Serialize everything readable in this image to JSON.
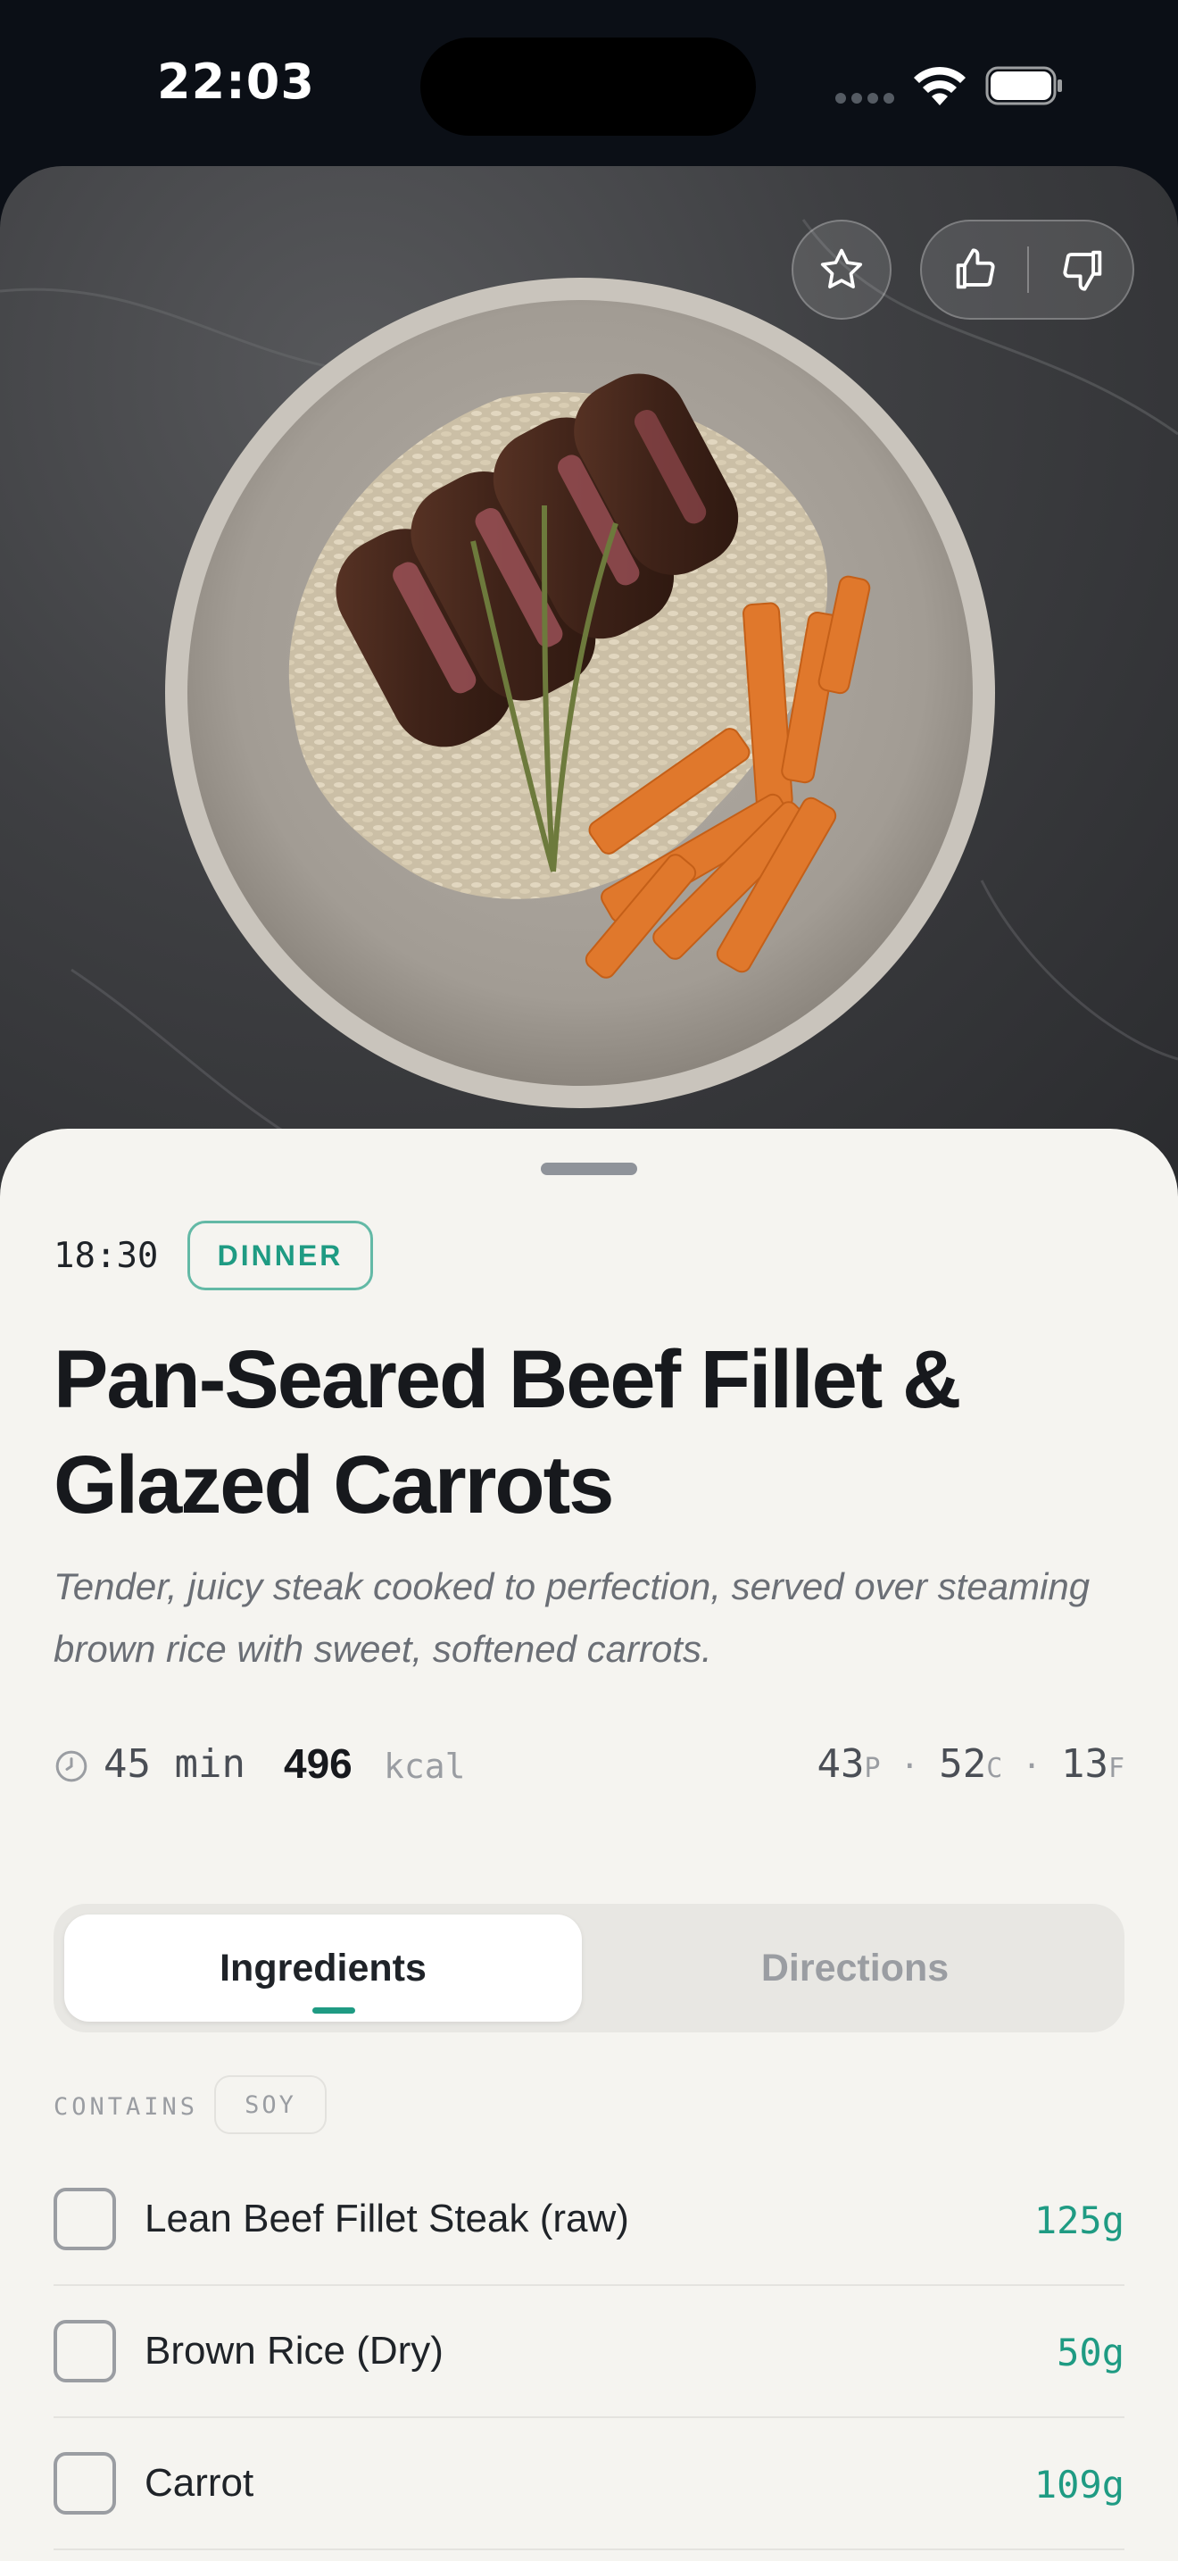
{
  "status_bar": {
    "time": "22:03"
  },
  "hero": {
    "image_alt": "Pan-seared beef fillet with thyme over brown rice and glazed carrots in a grey bowl",
    "favorite_icon": "star-icon",
    "like_icon": "thumbs-up-icon",
    "dislike_icon": "thumbs-down-icon"
  },
  "meal": {
    "time": "18:30",
    "type": "DINNER",
    "title": "Pan-Seared Beef Fillet & Glazed Carrots",
    "description": "Tender, juicy steak cooked to perfection, served over steaming brown rice with sweet, softened carrots.",
    "duration": "45 min",
    "kcal": "496",
    "kcal_unit": "kcal",
    "macros": {
      "protein": "43",
      "protein_unit": "P",
      "carbs": "52",
      "carbs_unit": "C",
      "fat": "13",
      "fat_unit": "F",
      "separator": "·"
    }
  },
  "tabs": [
    {
      "label": "Ingredients",
      "active": true
    },
    {
      "label": "Directions",
      "active": false
    }
  ],
  "contains": {
    "label": "CONTAINS",
    "allergens": [
      "SOY"
    ]
  },
  "ingredients": [
    {
      "name": "Lean Beef Fillet Steak (raw)",
      "qty": "125g",
      "checked": false
    },
    {
      "name": "Brown Rice (Dry)",
      "qty": "50g",
      "checked": false
    },
    {
      "name": "Carrot",
      "qty": "109g",
      "checked": false
    }
  ],
  "colors": {
    "accent": "#1f9b83",
    "sheet_bg": "#f5f4f0",
    "text": "#17191d"
  }
}
